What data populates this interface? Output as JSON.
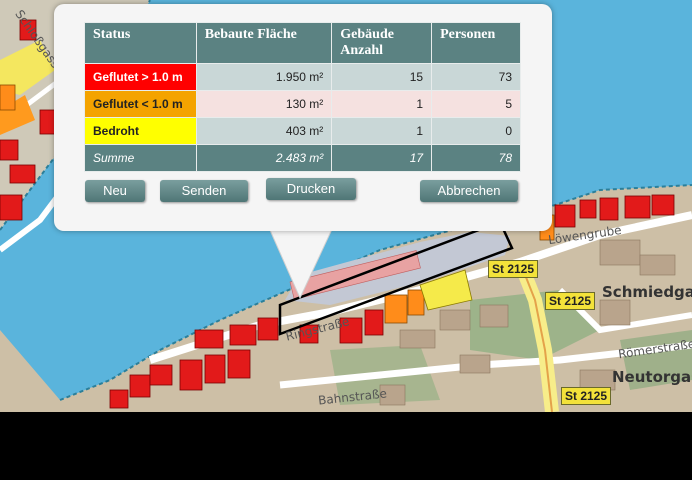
{
  "map": {
    "street_labels": [
      "Löwengrube",
      "Schmiedgasse",
      "Römerstraße",
      "Neutorgasse",
      "Ringstraße",
      "Bahnstraße",
      "Schloßgasse"
    ],
    "route_badges": [
      "St 2125",
      "St 2125",
      "St 2125"
    ]
  },
  "popup": {
    "headers": {
      "status": "Status",
      "area": "Bebaute Fläche",
      "buildings": "Gebäude Anzahl",
      "persons": "Personen"
    },
    "rows": [
      {
        "status": "Geflutet > 1.0 m",
        "area": "1.950 m²",
        "buildings": "15",
        "persons": "73",
        "color": "#ff0000",
        "text_color": "#ffffff"
      },
      {
        "status": "Geflutet < 1.0 m",
        "area": "130 m²",
        "buildings": "1",
        "persons": "5",
        "color": "#f4a300",
        "text_color": "#222222"
      },
      {
        "status": "Bedroht",
        "area": "403 m²",
        "buildings": "1",
        "persons": "0",
        "color": "#ffff00",
        "text_color": "#222222"
      }
    ],
    "sum": {
      "status": "Summe",
      "area": "2.483 m²",
      "buildings": "17",
      "persons": "78"
    },
    "buttons": {
      "new": "Neu",
      "send": "Senden",
      "print": "Drucken",
      "cancel": "Abbrechen"
    }
  }
}
